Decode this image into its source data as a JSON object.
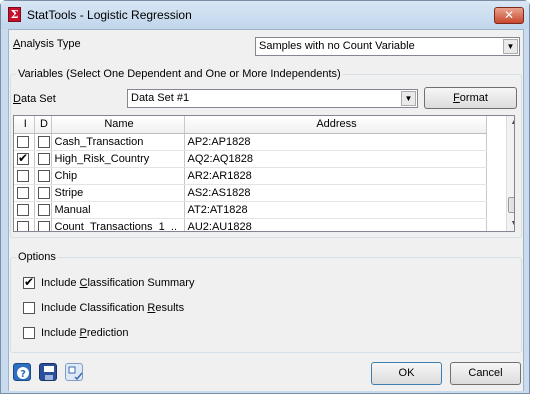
{
  "window": {
    "title": "StatTools - Logistic Regression"
  },
  "analysis_type": {
    "label_pre": "",
    "label_ul": "A",
    "label_post": "nalysis Type",
    "value": "Samples with no Count Variable"
  },
  "variables": {
    "legend": "Variables (Select One Dependent and One or More Independents)",
    "data_set_label_ul": "D",
    "data_set_label_post": "ata Set",
    "data_set_value": "Data Set #1",
    "format_pre": "",
    "format_ul": "F",
    "format_post": "ormat",
    "columns": [
      "I",
      "D",
      "Name",
      "Address"
    ],
    "rows": [
      {
        "i": false,
        "d": false,
        "name": "Cash_Transaction",
        "address": "AP2:AP1828"
      },
      {
        "i": true,
        "d": false,
        "name": "High_Risk_Country",
        "address": "AQ2:AQ1828"
      },
      {
        "i": false,
        "d": false,
        "name": "Chip",
        "address": "AR2:AR1828"
      },
      {
        "i": false,
        "d": false,
        "name": "Stripe",
        "address": "AS2:AS1828"
      },
      {
        "i": false,
        "d": false,
        "name": "Manual",
        "address": "AT2:AT1828"
      },
      {
        "i": false,
        "d": false,
        "name": "Count_Transactions_1_..",
        "address": "AU2:AU1828"
      }
    ]
  },
  "options": {
    "legend": "Options",
    "items": [
      {
        "pre": "Include ",
        "ul": "C",
        "post": "lassification Summary",
        "checked": true
      },
      {
        "pre": "Include Classification ",
        "ul": "R",
        "post": "esults",
        "checked": false
      },
      {
        "pre": "Include ",
        "ul": "P",
        "post": "rediction",
        "checked": false
      }
    ]
  },
  "footer": {
    "ok_label": "OK",
    "cancel_label": "Cancel",
    "icons": [
      "help-icon",
      "save-icon",
      "settings-icon"
    ]
  },
  "colors": {
    "close_button": "#c9462b",
    "app_icon": "#c8102e"
  }
}
